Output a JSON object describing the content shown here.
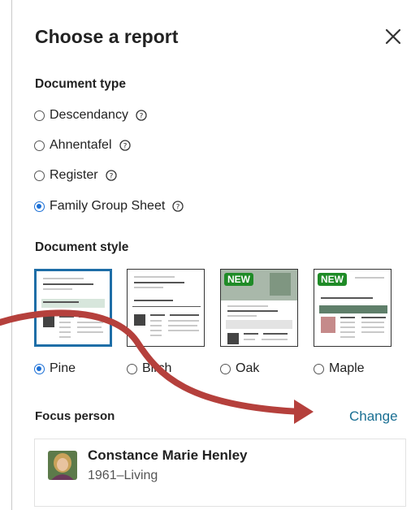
{
  "dialog": {
    "title": "Choose a report"
  },
  "document_type": {
    "heading": "Document type",
    "options": [
      {
        "label": "Descendancy",
        "selected": false
      },
      {
        "label": "Ahnentafel",
        "selected": false
      },
      {
        "label": "Register",
        "selected": false
      },
      {
        "label": "Family Group Sheet",
        "selected": true
      }
    ]
  },
  "document_style": {
    "heading": "Document style",
    "badge": "NEW",
    "styles": [
      {
        "label": "Pine",
        "selected": true,
        "is_new": false
      },
      {
        "label": "Birch",
        "selected": false,
        "is_new": false
      },
      {
        "label": "Oak",
        "selected": false,
        "is_new": true
      },
      {
        "label": "Maple",
        "selected": false,
        "is_new": true
      }
    ]
  },
  "focus_person": {
    "heading": "Focus person",
    "change_label": "Change",
    "name": "Constance Marie Henley",
    "dates": "1961–Living"
  },
  "colors": {
    "accent": "#1a6fd6",
    "link": "#1a6f93",
    "badge": "#1f8b27",
    "arrow": "#b5403c"
  }
}
